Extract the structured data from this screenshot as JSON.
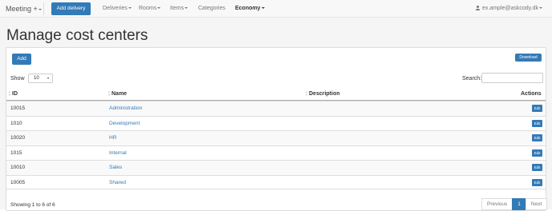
{
  "nav": {
    "brand": "Meeting",
    "add_delivery": "Add delivery",
    "menu": [
      {
        "label": "Deliveries",
        "active": false
      },
      {
        "label": "Rooms",
        "active": false
      },
      {
        "label": "Items",
        "active": false
      },
      {
        "label": "Categories",
        "active": false
      },
      {
        "label": "Economy",
        "active": true
      }
    ],
    "user_email": "ex.ample@askcody.dk"
  },
  "page": {
    "title": "Manage cost centers",
    "add_label": "Add",
    "download_label": "Download"
  },
  "table_controls": {
    "show_label": "Show",
    "page_size": "10",
    "search_label": "Search:",
    "search_value": ""
  },
  "table": {
    "columns": [
      "ID",
      "Name",
      "Description",
      "Actions"
    ],
    "edit_label": "Edit",
    "rows": [
      {
        "id": "10015",
        "name": "Administration",
        "description": ""
      },
      {
        "id": "1010",
        "name": "Development",
        "description": ""
      },
      {
        "id": "10020",
        "name": "HR",
        "description": ""
      },
      {
        "id": "1015",
        "name": "Internal",
        "description": ""
      },
      {
        "id": "10010",
        "name": "Sales",
        "description": ""
      },
      {
        "id": "10005",
        "name": "Shared",
        "description": ""
      }
    ]
  },
  "footer": {
    "info": "Showing 1 to 6 of 6",
    "pagination": {
      "previous": "Previous",
      "current": "1",
      "next": "Next"
    }
  },
  "colors": {
    "primary": "#337ab7",
    "navbar_bg": "#f8f8f8",
    "page_bg": "#f5f5f5"
  }
}
